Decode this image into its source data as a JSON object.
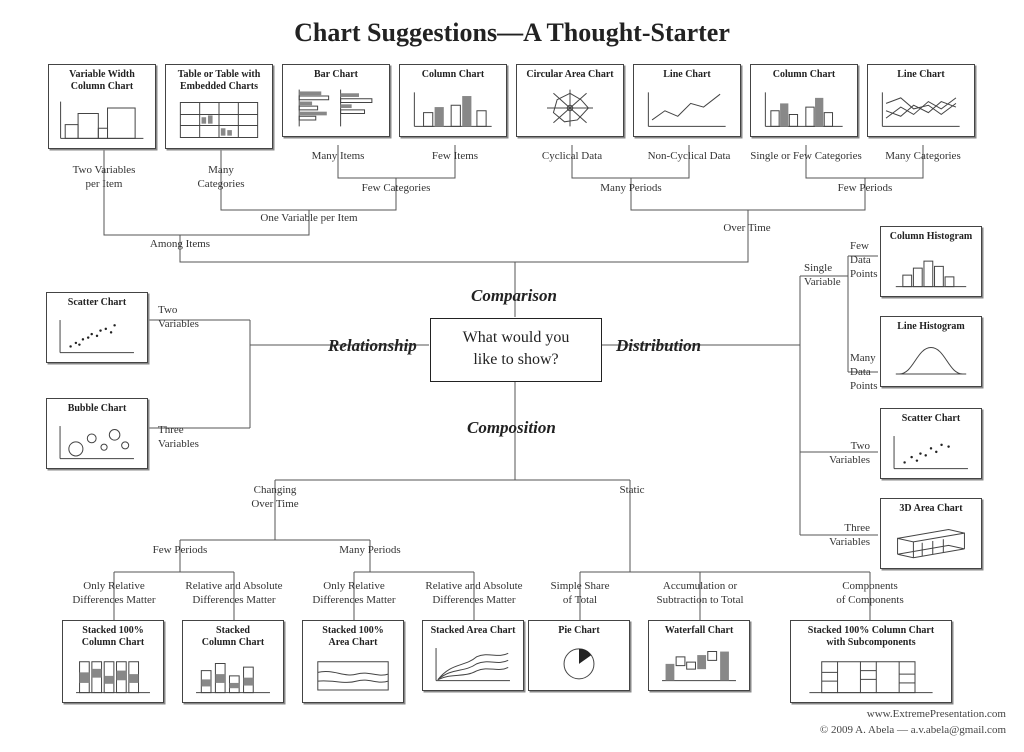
{
  "title": "Chart Suggestions—A Thought-Starter",
  "center_question": "What would you\nlike to show?",
  "categories": {
    "comparison": "Comparison",
    "relationship": "Relationship",
    "distribution": "Distribution",
    "composition": "Composition"
  },
  "credit_site": "www.ExtremePresentation.com",
  "credit_copy": "© 2009  A. Abela — a.v.abela@gmail.com",
  "top_charts": [
    {
      "name": "Variable Width\nColumn Chart"
    },
    {
      "name": "Table or Table with\nEmbedded Charts"
    },
    {
      "name": "Bar Chart"
    },
    {
      "name": "Column Chart"
    },
    {
      "name": "Circular Area Chart"
    },
    {
      "name": "Line Chart"
    },
    {
      "name": "Column Chart"
    },
    {
      "name": "Line Chart"
    }
  ],
  "relationship_charts": [
    {
      "name": "Scatter Chart"
    },
    {
      "name": "Bubble Chart"
    }
  ],
  "distribution_charts": [
    {
      "name": "Column Histogram"
    },
    {
      "name": "Line Histogram"
    },
    {
      "name": "Scatter Chart"
    },
    {
      "name": "3D Area Chart"
    }
  ],
  "composition_charts": [
    {
      "name": "Stacked 100%\nColumn Chart"
    },
    {
      "name": "Stacked\nColumn Chart"
    },
    {
      "name": "Stacked 100%\nArea Chart"
    },
    {
      "name": "Stacked Area Chart"
    },
    {
      "name": "Pie Chart"
    },
    {
      "name": "Waterfall Chart"
    },
    {
      "name": "Stacked 100% Column Chart\nwith Subcomponents"
    }
  ],
  "labels": {
    "two_vars_per_item": "Two Variables\nper Item",
    "many_categories": "Many\nCategories",
    "many_items": "Many Items",
    "few_items": "Few Items",
    "few_categories": "Few Categories",
    "one_var_per_item": "One Variable per Item",
    "among_items": "Among Items",
    "cyclical": "Cyclical Data",
    "non_cyclical": "Non-Cyclical Data",
    "single_or_few_cat": "Single or Few Categories",
    "many_categories2": "Many Categories",
    "many_periods": "Many Periods",
    "few_periods_top": "Few Periods",
    "over_time": "Over Time",
    "two_variables": "Two\nVariables",
    "three_variables": "Three\nVariables",
    "single_variable": "Single\nVariable",
    "few_data_points": "Few\nData\nPoints",
    "many_data_points": "Many\nData\nPoints",
    "two_variables2": "Two\nVariables",
    "three_variables2": "Three\nVariables",
    "changing_over_time": "Changing\nOver Time",
    "static": "Static",
    "few_periods_bottom": "Few Periods",
    "many_periods_bottom": "Many Periods",
    "only_rel_diff": "Only Relative\nDifferences Matter",
    "rel_abs_diff": "Relative and Absolute\nDifferences Matter",
    "only_rel_diff2": "Only Relative\nDifferences Matter",
    "rel_abs_diff2": "Relative and Absolute\nDifferences Matter",
    "simple_share": "Simple Share\nof Total",
    "accum_sub": "Accumulation or\nSubtraction to Total",
    "components": "Components\nof Components"
  }
}
